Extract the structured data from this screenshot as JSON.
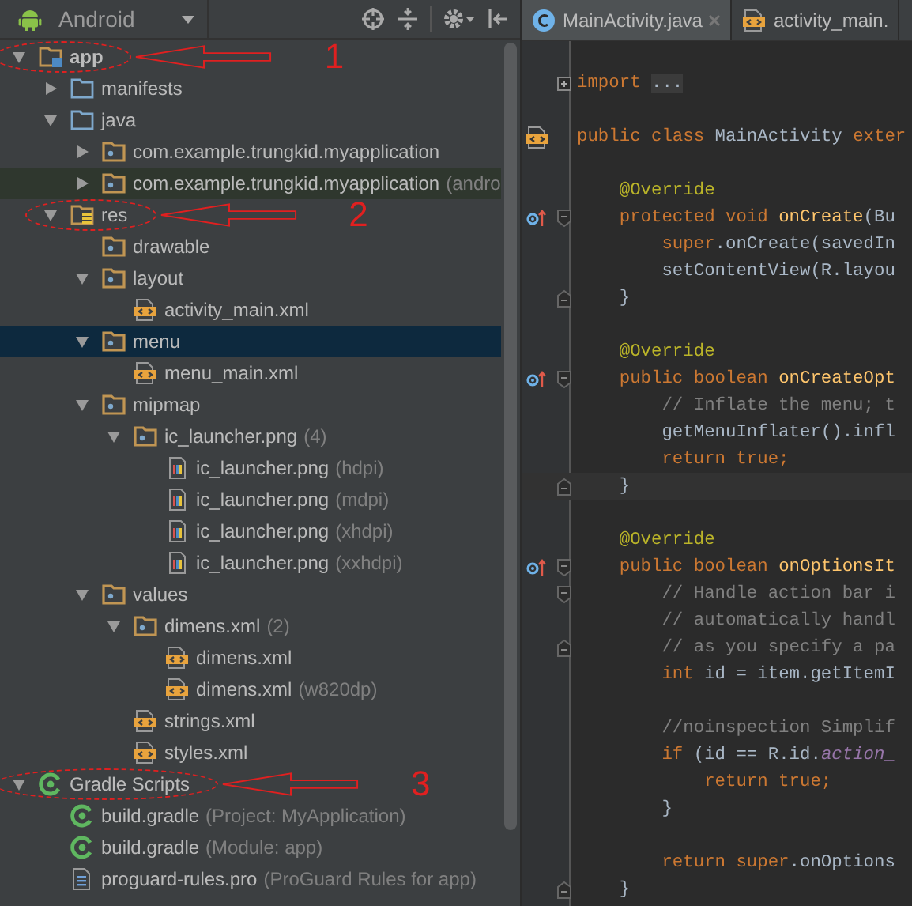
{
  "toolbar": {
    "view": "Android"
  },
  "tree": [
    {
      "label": "app",
      "kind": "module",
      "bold": true,
      "expanded": true,
      "selected": false,
      "hovered": false,
      "annotation": "1",
      "children": [
        {
          "label": "manifests",
          "kind": "folder",
          "expanded": false,
          "selected": false,
          "hovered": false
        },
        {
          "label": "java",
          "kind": "folder",
          "expanded": true,
          "selected": false,
          "hovered": false,
          "children": [
            {
              "label": "com.example.trungkid.myapplication",
              "kind": "package",
              "expanded": false,
              "selected": false,
              "hovered": false
            },
            {
              "label": "com.example.trungkid.myapplication",
              "note": "(andro",
              "kind": "package",
              "expanded": false,
              "selected": false,
              "hovered": true
            }
          ]
        },
        {
          "label": "res",
          "kind": "res",
          "expanded": true,
          "selected": false,
          "hovered": false,
          "annotation": "2",
          "children": [
            {
              "label": "drawable",
              "kind": "package",
              "selected": false,
              "hovered": false
            },
            {
              "label": "layout",
              "kind": "package",
              "expanded": true,
              "selected": false,
              "hovered": false,
              "children": [
                {
                  "label": "activity_main.xml",
                  "kind": "xml",
                  "selected": false,
                  "hovered": false
                }
              ]
            },
            {
              "label": "menu",
              "kind": "package",
              "expanded": true,
              "selected": true,
              "hovered": false,
              "children": [
                {
                  "label": "menu_main.xml",
                  "kind": "xml",
                  "selected": false,
                  "hovered": false
                }
              ]
            },
            {
              "label": "mipmap",
              "kind": "package",
              "expanded": true,
              "selected": false,
              "hovered": false,
              "children": [
                {
                  "label": "ic_launcher.png",
                  "note": "(4)",
                  "kind": "package",
                  "expanded": true,
                  "selected": false,
                  "hovered": false,
                  "children": [
                    {
                      "label": "ic_launcher.png",
                      "note": "(hdpi)",
                      "kind": "image",
                      "selected": false,
                      "hovered": false
                    },
                    {
                      "label": "ic_launcher.png",
                      "note": "(mdpi)",
                      "kind": "image",
                      "selected": false,
                      "hovered": false
                    },
                    {
                      "label": "ic_launcher.png",
                      "note": "(xhdpi)",
                      "kind": "image",
                      "selected": false,
                      "hovered": false
                    },
                    {
                      "label": "ic_launcher.png",
                      "note": "(xxhdpi)",
                      "kind": "image",
                      "selected": false,
                      "hovered": false
                    }
                  ]
                }
              ]
            },
            {
              "label": "values",
              "kind": "package",
              "expanded": true,
              "selected": false,
              "hovered": false,
              "children": [
                {
                  "label": "dimens.xml",
                  "note": "(2)",
                  "kind": "package",
                  "expanded": true,
                  "selected": false,
                  "hovered": false,
                  "children": [
                    {
                      "label": "dimens.xml",
                      "kind": "xml",
                      "selected": false,
                      "hovered": false
                    },
                    {
                      "label": "dimens.xml",
                      "note": "(w820dp)",
                      "kind": "xml",
                      "selected": false,
                      "hovered": false
                    }
                  ]
                },
                {
                  "label": "strings.xml",
                  "kind": "xml",
                  "selected": false,
                  "hovered": false
                },
                {
                  "label": "styles.xml",
                  "kind": "xml",
                  "selected": false,
                  "hovered": false
                }
              ]
            }
          ]
        }
      ]
    },
    {
      "label": "Gradle Scripts",
      "kind": "gradle",
      "expanded": true,
      "selected": false,
      "hovered": false,
      "annotation": "3",
      "children": [
        {
          "label": "build.gradle",
          "note": "(Project: MyApplication)",
          "kind": "gradle",
          "selected": false,
          "hovered": false
        },
        {
          "label": "build.gradle",
          "note": "(Module: app)",
          "kind": "gradle",
          "selected": false,
          "hovered": false
        },
        {
          "label": "proguard-rules.pro",
          "note": "(ProGuard Rules for app)",
          "kind": "text",
          "selected": false,
          "hovered": false
        }
      ]
    }
  ],
  "editor_tabs": [
    {
      "label": "MainActivity.java",
      "kind": "class",
      "selected": true,
      "closable": true
    },
    {
      "label": "activity_main.",
      "kind": "xml",
      "selected": false,
      "closable": false
    }
  ],
  "code_lines": [
    {
      "kind": "code",
      "markers": [
        {
          "kind": "unfold"
        }
      ],
      "tokens": [
        {
          "text": "import ",
          "kind": "keyword"
        },
        {
          "text": "...",
          "kind": "folded"
        }
      ]
    },
    {
      "kind": "blank"
    },
    {
      "kind": "code",
      "markers": [
        {
          "kind": "layout"
        }
      ],
      "tokens": [
        {
          "text": "public class ",
          "kind": "keyword"
        },
        {
          "text": "MainActivity ",
          "kind": "plain"
        },
        {
          "text": "exter",
          "kind": "keyword"
        }
      ]
    },
    {
      "kind": "blank"
    },
    {
      "kind": "code",
      "tokens": [
        {
          "text": "    @Override",
          "kind": "annotation"
        }
      ]
    },
    {
      "kind": "code",
      "markers": [
        {
          "kind": "override"
        },
        {
          "kind": "foldopen"
        }
      ],
      "tokens": [
        {
          "text": "    protected void ",
          "kind": "keyword"
        },
        {
          "text": "onCreate",
          "kind": "method"
        },
        {
          "text": "(Bu",
          "kind": "plain"
        }
      ]
    },
    {
      "kind": "code",
      "tokens": [
        {
          "text": "        super",
          "kind": "keyword"
        },
        {
          "text": ".onCreate(savedIn",
          "kind": "plain"
        }
      ]
    },
    {
      "kind": "code",
      "tokens": [
        {
          "text": "        setContentView(R.layou",
          "kind": "plain"
        }
      ]
    },
    {
      "kind": "code",
      "markers": [
        {
          "kind": "foldclose"
        }
      ],
      "tokens": [
        {
          "text": "    }",
          "kind": "plain"
        }
      ]
    },
    {
      "kind": "blank"
    },
    {
      "kind": "code",
      "tokens": [
        {
          "text": "    @Override",
          "kind": "annotation"
        }
      ]
    },
    {
      "kind": "code",
      "markers": [
        {
          "kind": "override"
        },
        {
          "kind": "foldopen"
        }
      ],
      "tokens": [
        {
          "text": "    public boolean ",
          "kind": "keyword"
        },
        {
          "text": "onCreateOpt",
          "kind": "method"
        }
      ]
    },
    {
      "kind": "code",
      "tokens": [
        {
          "text": "        // Inflate the menu; t",
          "kind": "comment"
        }
      ]
    },
    {
      "kind": "code",
      "tokens": [
        {
          "text": "        getMenuInflater().infl",
          "kind": "plain"
        }
      ]
    },
    {
      "kind": "code",
      "tokens": [
        {
          "text": "        return true;",
          "kind": "keyword"
        }
      ]
    },
    {
      "kind": "code",
      "current": true,
      "markers": [
        {
          "kind": "foldclose"
        }
      ],
      "tokens": [
        {
          "text": "    }",
          "kind": "plain"
        }
      ]
    },
    {
      "kind": "blank"
    },
    {
      "kind": "code",
      "tokens": [
        {
          "text": "    @Override",
          "kind": "annotation"
        }
      ]
    },
    {
      "kind": "code",
      "markers": [
        {
          "kind": "override"
        },
        {
          "kind": "foldopen"
        }
      ],
      "tokens": [
        {
          "text": "    public boolean ",
          "kind": "keyword"
        },
        {
          "text": "onOptionsIt",
          "kind": "method"
        }
      ]
    },
    {
      "kind": "code",
      "markers": [
        {
          "kind": "foldopen"
        }
      ],
      "tokens": [
        {
          "text": "        // Handle action bar i",
          "kind": "comment"
        }
      ]
    },
    {
      "kind": "code",
      "tokens": [
        {
          "text": "        // automatically handl",
          "kind": "comment"
        }
      ]
    },
    {
      "kind": "code",
      "markers": [
        {
          "kind": "foldclose"
        }
      ],
      "tokens": [
        {
          "text": "        // as you specify a pa",
          "kind": "comment"
        }
      ]
    },
    {
      "kind": "code",
      "tokens": [
        {
          "text": "        int ",
          "kind": "keyword"
        },
        {
          "text": "id = item.getItemI",
          "kind": "plain"
        }
      ]
    },
    {
      "kind": "blank"
    },
    {
      "kind": "code",
      "tokens": [
        {
          "text": "        //noinspection Simplif",
          "kind": "comment"
        }
      ]
    },
    {
      "kind": "code",
      "tokens": [
        {
          "text": "        if ",
          "kind": "keyword"
        },
        {
          "text": "(id == R.id.",
          "kind": "plain"
        },
        {
          "text": "action_",
          "kind": "field"
        }
      ]
    },
    {
      "kind": "code",
      "tokens": [
        {
          "text": "            return true;",
          "kind": "keyword"
        }
      ]
    },
    {
      "kind": "code",
      "tokens": [
        {
          "text": "        }",
          "kind": "plain"
        }
      ]
    },
    {
      "kind": "blank"
    },
    {
      "kind": "code",
      "tokens": [
        {
          "text": "        return super",
          "kind": "keyword"
        },
        {
          "text": ".onOptions",
          "kind": "plain"
        }
      ]
    },
    {
      "kind": "code",
      "markers": [
        {
          "kind": "foldclose"
        }
      ],
      "tokens": [
        {
          "text": "    }",
          "kind": "plain"
        }
      ]
    }
  ]
}
